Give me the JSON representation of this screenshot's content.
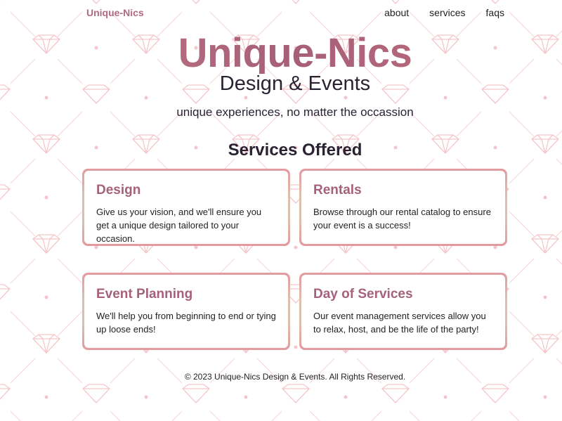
{
  "nav": {
    "brand": "Unique-Nics",
    "links": [
      "about",
      "services",
      "faqs"
    ]
  },
  "hero": {
    "title": "Unique-Nics",
    "subtitle": "Design & Events",
    "tagline": "unique experiences, no matter the occassion"
  },
  "services": {
    "heading": "Services Offered",
    "cards": [
      {
        "title": "Design",
        "description": "Give us your vision, and we'll ensure you get a unique design tailored to your occasion."
      },
      {
        "title": "Rentals",
        "description": "Browse through our rental catalog to ensure your event is a success!"
      },
      {
        "title": "Event Planning",
        "description": "We'll help you from beginning to end or tying up loose ends!"
      },
      {
        "title": "Day of Services",
        "description": "Our event management services allow you to relax, host, and be the life of the party!"
      }
    ]
  },
  "footer": {
    "text": "© 2023 Unique-Nics Design & Events. All Rights Reserved."
  },
  "colors": {
    "accent": "#a5617b",
    "card_border": "#dcc0ad",
    "card_border_highlight": "#e39aa0",
    "pattern": "#f3c9cc"
  },
  "icons": {
    "background_pattern": "diamond-icon"
  }
}
